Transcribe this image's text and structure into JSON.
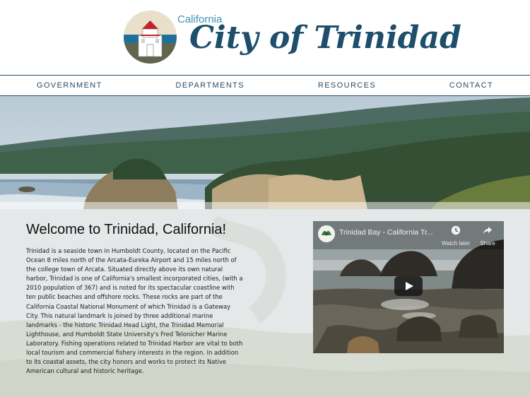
{
  "header": {
    "logo_small": "California",
    "logo_main": "City of Trinidad"
  },
  "nav": {
    "items": [
      "GOVERNMENT",
      "DEPARTMENTS",
      "RESOURCES",
      "CONTACT"
    ]
  },
  "main": {
    "welcome_title": "Welcome to Trinidad, California!",
    "welcome_text": "Trinidad is a seaside town in Humboldt County, located on the Pacific Ocean 8 miles north of the Arcata-Eureka Airport and 15 miles north of the college town of Arcata. Situated directly above its own natural harbor, Trinidad is one of California's smallest incorporated cities, (with a 2010 population of 367) and is noted for its spectacular coastline with ten public beaches and offshore rocks. These rocks are part of the California Coastal National Monument of which Trinidad is a Gateway City. This natural landmark is joined by three additional marine landmarks - the historic Trinidad Head Light, the Trinidad Memorial Lighthouse, and Humboldt State University's Fred Telonicher Marine Laboratory. Fishing operations related to Trinidad Harbor are vital to both local tourism and commercial fishery interests in the region. In addition to its coastal assets, the city honors and works to protect its Native American cultural and historic heritage."
  },
  "video": {
    "title": "Trinidad Bay - California Tr...",
    "watch_later": "Watch later",
    "share": "Share",
    "icons": [
      "channel-avatar-icon",
      "clock-icon",
      "share-arrow-icon",
      "play-icon"
    ]
  },
  "colors": {
    "brand_dark": "#1d4e6b",
    "brand_light": "#3f8fb8",
    "nav_text": "#2b4b63",
    "lighthouse_red": "#c4222a"
  }
}
